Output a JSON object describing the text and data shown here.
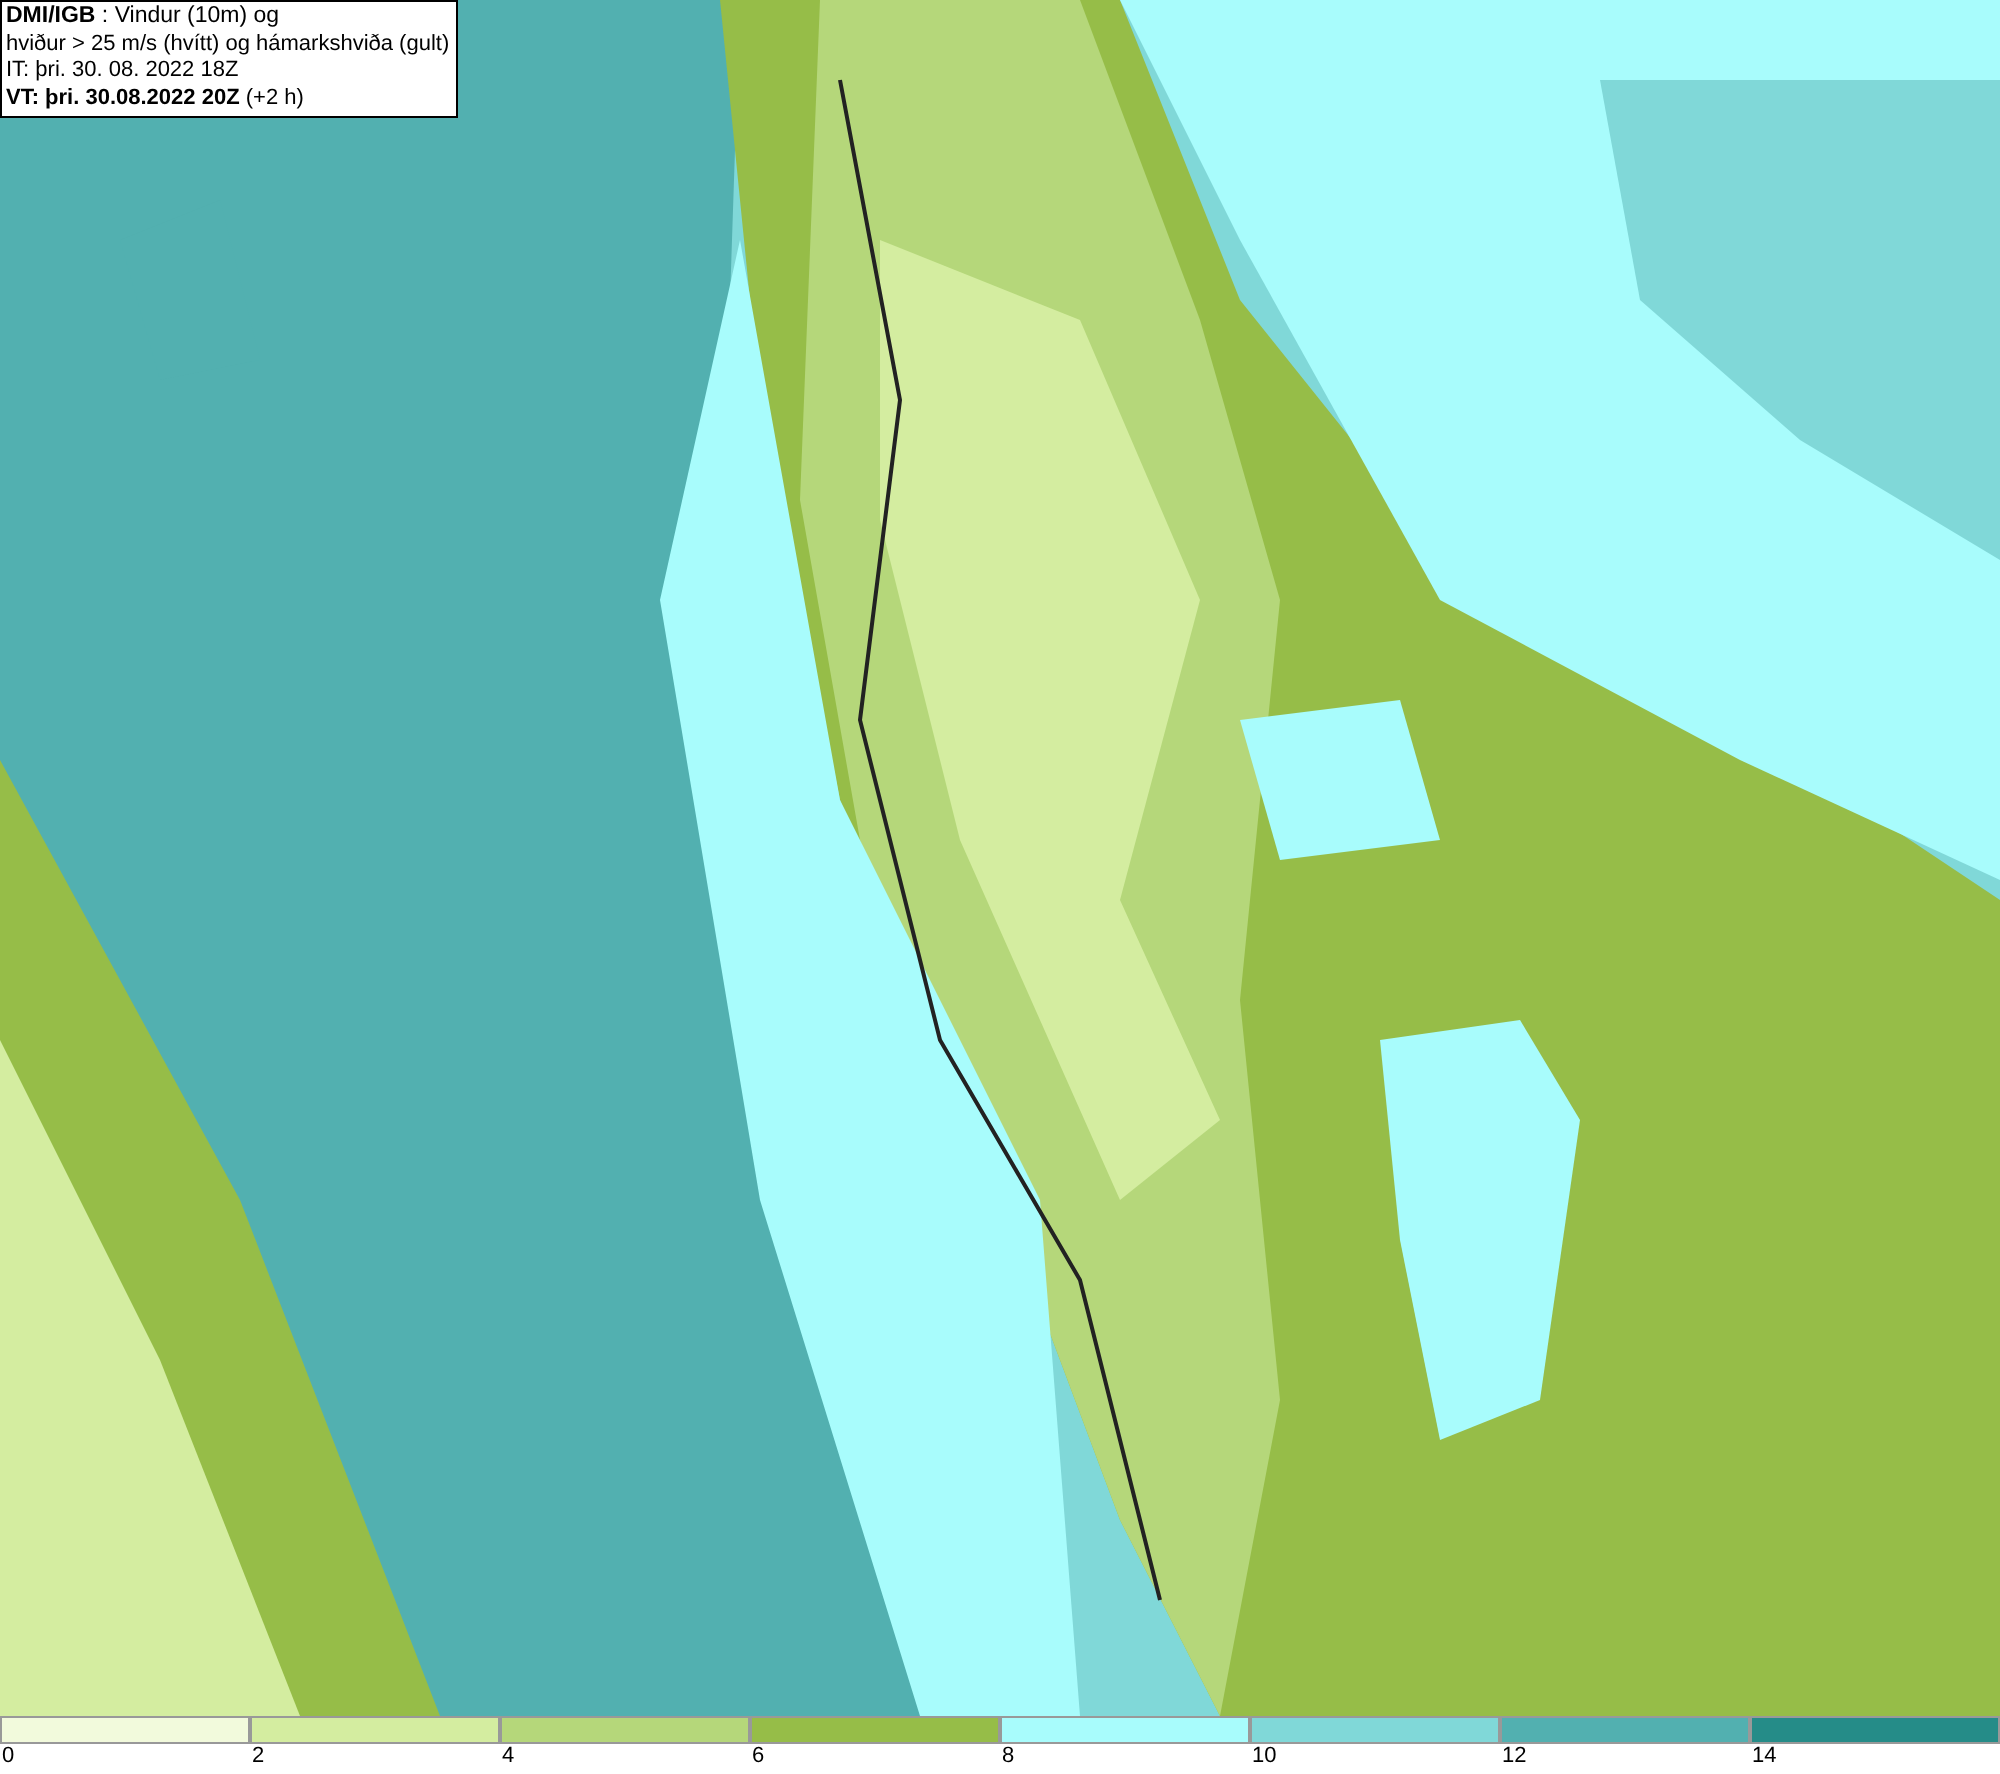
{
  "info_box": {
    "lines": [
      "**DMI/IGB** : Vindur (10m) og",
      "hviður > 25 m/s (hvítt) og hámarkshviða (gult)",
      "IT: þri. 30. 08. 2022 18Z",
      "**VT: þri. 30.08.2022 20Z** (+2 h)"
    ]
  },
  "legend": [
    {
      "label": "0",
      "color": "#f2fadc"
    },
    {
      "label": "2",
      "color": "#d4eda0"
    },
    {
      "label": "4",
      "color": "#b5d77a"
    },
    {
      "label": "6",
      "color": "#96bd48"
    },
    {
      "label": "8",
      "color": "#a8fcfc"
    },
    {
      "label": "10",
      "color": "#80d8d8"
    },
    {
      "label": "12",
      "color": "#52b0b0"
    },
    {
      "label": "14",
      "color": "#258c88"
    }
  ]
}
